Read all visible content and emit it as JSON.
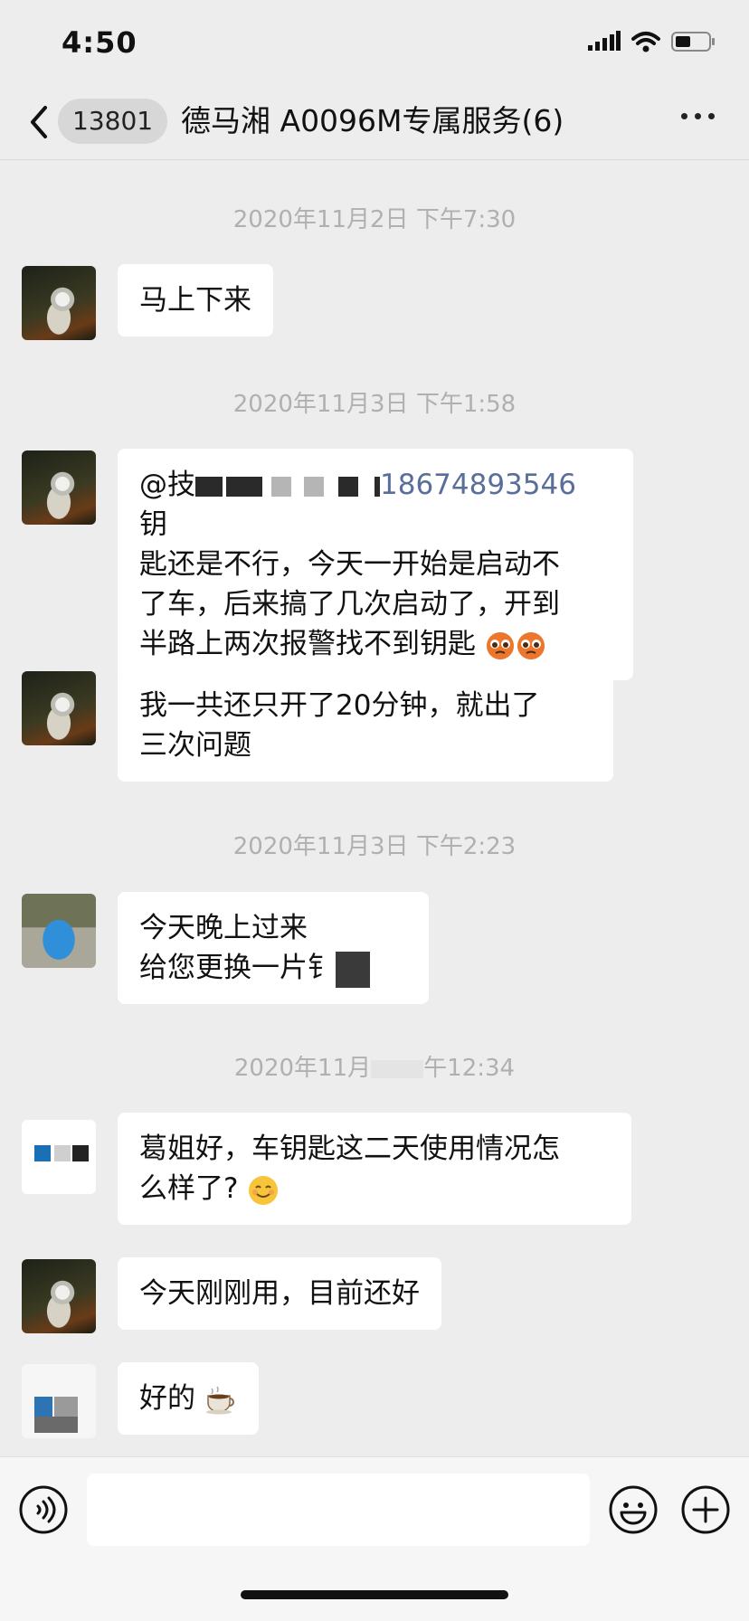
{
  "status": {
    "time": "4:50"
  },
  "nav": {
    "unread": "13801",
    "title": "德马湘 A0096M专属服务(6)"
  },
  "timestamps": [
    "2020年11月2日 下午7:30",
    "2020年11月3日 下午1:58",
    "2020年11月3日 下午2:23",
    "2020年11月",
    "午12:34"
  ],
  "messages": {
    "m1": "马上下来",
    "m2": {
      "mention": "@技",
      "phone": "18674893546",
      "line1_end": " 钥",
      "line2": "匙还是不行，今天一开始是启动不",
      "line3": "了车，后来搞了几次启动了，开到",
      "line4": "半路上两次报警找不到钥匙"
    },
    "m3": {
      "line1": "我一共还只开了20分钟，就出了",
      "line2": "三次问题"
    },
    "m4": {
      "line1": "今天晚上过来",
      "line2": "给您更换一片钅"
    },
    "m5": {
      "line1": "葛姐好，车钥匙这二天使用情况怎",
      "line2": "么样了?"
    },
    "m6": "今天刚刚用，目前还好",
    "m7": "好的"
  },
  "icons": {
    "back": "chevron-left-icon",
    "more": "more-dots-icon",
    "voice": "voice-icon",
    "emoji": "emoji-icon",
    "plus": "plus-icon"
  }
}
